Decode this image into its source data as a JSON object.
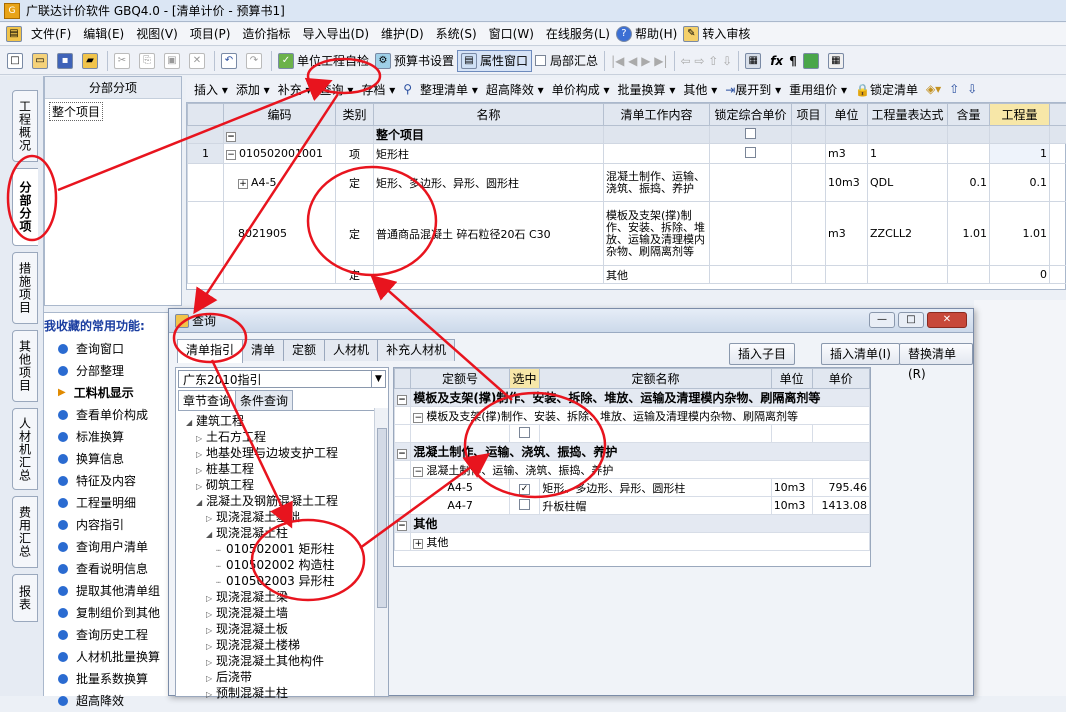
{
  "window": {
    "title": "广联达计价软件 GBQ4.0 - [清单计价 - 预算书1]"
  },
  "menu": [
    "文件(F)",
    "编辑(E)",
    "视图(V)",
    "项目(P)",
    "造价指标",
    "导入导出(D)",
    "维护(D)",
    "系统(S)",
    "窗口(W)",
    "在线服务(L)",
    "帮助(H)",
    "转入审核"
  ],
  "toolbar1": {
    "btn_self_check": "单位工程自检",
    "btn_budget_settings": "预算书设置",
    "btn_property_window": "属性窗口",
    "chk_local_summary": "局部汇总"
  },
  "toolbar2": [
    "插入 ▾",
    "添加 ▾",
    "补充 ▾",
    "查询 ▾",
    "存档 ▾",
    "整理清单 ▾",
    "超高降效 ▾",
    "单价构成 ▾",
    "批量换算 ▾",
    "其他 ▾",
    "展开到 ▾",
    "重用组价 ▾",
    "锁定清单"
  ],
  "left_tabs": [
    "工程概况",
    "分部分项",
    "措施项目",
    "其他项目",
    "人材机汇总",
    "费用汇总",
    "报表"
  ],
  "left_panel": {
    "header": "分部分项",
    "node": "整个项目"
  },
  "favorites": {
    "header": "我收藏的常用功能:",
    "items": [
      "查询窗口",
      "分部整理",
      "工料机显示",
      "查看单价构成",
      "标准换算",
      "换算信息",
      "特征及内容",
      "工程量明细",
      "内容指引",
      "查询用户清单",
      "查看说明信息",
      "提取其他清单组",
      "复制组价到其他",
      "查询历史工程",
      "人材机批量换算",
      "批量系数换算",
      "超高降效"
    ]
  },
  "grid": {
    "headers": [
      "编码",
      "类别",
      "名称",
      "清单工作内容",
      "锁定综合单价",
      "项目",
      "单位",
      "工程量表达式",
      "含量",
      "工程量"
    ],
    "rows": [
      {
        "no": "",
        "code": "",
        "type": "",
        "name": "整个项目",
        "content": "",
        "unit": "",
        "expr": "",
        "qty_ratio": "",
        "qty": ""
      },
      {
        "no": "1",
        "code": "010502001001",
        "type": "项",
        "name": "矩形柱",
        "content": "",
        "unit": "m3",
        "expr": "1",
        "qty_ratio": "",
        "qty": "1"
      },
      {
        "no": "",
        "code": "A4-5",
        "type": "定",
        "name": "矩形、多边形、异形、圆形柱",
        "content": "混凝土制作、运输、浇筑、振捣、养护",
        "unit": "10m3",
        "expr": "QDL",
        "qty_ratio": "0.1",
        "qty": "0.1"
      },
      {
        "no": "",
        "code": "8021905",
        "type": "定",
        "name": "普通商品混凝土 碎石粒径20石 C30",
        "content": "模板及支架(撑)制作、安装、拆除、堆放、运输及清理模内杂物、刷隔离剂等",
        "unit": "m3",
        "expr": "ZZCLL2",
        "qty_ratio": "1.01",
        "qty": "1.01"
      },
      {
        "no": "",
        "code": "",
        "type": "定",
        "name": "",
        "content": "其他",
        "unit": "",
        "expr": "",
        "qty_ratio": "",
        "qty": "0"
      }
    ]
  },
  "dialog": {
    "title": "查询",
    "tabs": [
      "清单指引",
      "清单",
      "定额",
      "人材机",
      "补充人材机"
    ],
    "buttons": [
      "插入子目",
      "插入清单(I)",
      "替换清单(R)"
    ],
    "select": "广东2010指引",
    "subtabs": [
      "章节查询",
      "条件查询"
    ],
    "tree": [
      {
        "indent": 1,
        "tw": "◢",
        "text": "建筑工程"
      },
      {
        "indent": 2,
        "tw": "▷",
        "text": "土石方工程"
      },
      {
        "indent": 2,
        "tw": "▷",
        "text": "地基处理与边坡支护工程"
      },
      {
        "indent": 2,
        "tw": "▷",
        "text": "桩基工程"
      },
      {
        "indent": 2,
        "tw": "▷",
        "text": "砌筑工程"
      },
      {
        "indent": 2,
        "tw": "◢",
        "text": "混凝土及钢筋混凝土工程"
      },
      {
        "indent": 3,
        "tw": "▷",
        "text": "现浇混凝土基础"
      },
      {
        "indent": 3,
        "tw": "◢",
        "text": "现浇混凝土柱"
      },
      {
        "indent": 4,
        "tw": "",
        "text": "010502001  矩形柱"
      },
      {
        "indent": 4,
        "tw": "",
        "text": "010502002  构造柱"
      },
      {
        "indent": 4,
        "tw": "",
        "text": "010502003  异形柱"
      },
      {
        "indent": 3,
        "tw": "▷",
        "text": "现浇混凝土梁"
      },
      {
        "indent": 3,
        "tw": "▷",
        "text": "现浇混凝土墙"
      },
      {
        "indent": 3,
        "tw": "▷",
        "text": "现浇混凝土板"
      },
      {
        "indent": 3,
        "tw": "▷",
        "text": "现浇混凝土楼梯"
      },
      {
        "indent": 3,
        "tw": "▷",
        "text": "现浇混凝土其他构件"
      },
      {
        "indent": 3,
        "tw": "▷",
        "text": "后浇带"
      },
      {
        "indent": 3,
        "tw": "▷",
        "text": "预制混凝土柱"
      }
    ],
    "right_headers": [
      "定额号",
      "选中",
      "定额名称",
      "单位",
      "单价"
    ],
    "right_rows": [
      {
        "kind": "grp",
        "text": "模板及支架(撑)制作、安装、拆除、堆放、运输及清理模内杂物、刷隔离剂等"
      },
      {
        "kind": "sub",
        "text": "模板及支架(撑)制作、安装、拆除、堆放、运输及清理模内杂物、刷隔离剂等"
      },
      {
        "kind": "row",
        "code": "",
        "checked": false,
        "name": "",
        "unit": "",
        "price": ""
      },
      {
        "kind": "grp",
        "text": "混凝土制作、运输、浇筑、振捣、养护"
      },
      {
        "kind": "sub",
        "text": "混凝土制作、运输、浇筑、振捣、养护"
      },
      {
        "kind": "row",
        "code": "A4-5",
        "checked": true,
        "name": "矩形、多边形、异形、圆形柱",
        "unit": "10m3",
        "price": "795.46"
      },
      {
        "kind": "row",
        "code": "A4-7",
        "checked": false,
        "name": "升板柱帽",
        "unit": "10m3",
        "price": "1413.08"
      },
      {
        "kind": "grp",
        "text": "其他"
      },
      {
        "kind": "sub",
        "text": "其他"
      }
    ]
  },
  "colors": {
    "annotation": "#e8141e",
    "accent_blue": "#2a6bd1",
    "highlight_col": "#f7e7a8"
  }
}
